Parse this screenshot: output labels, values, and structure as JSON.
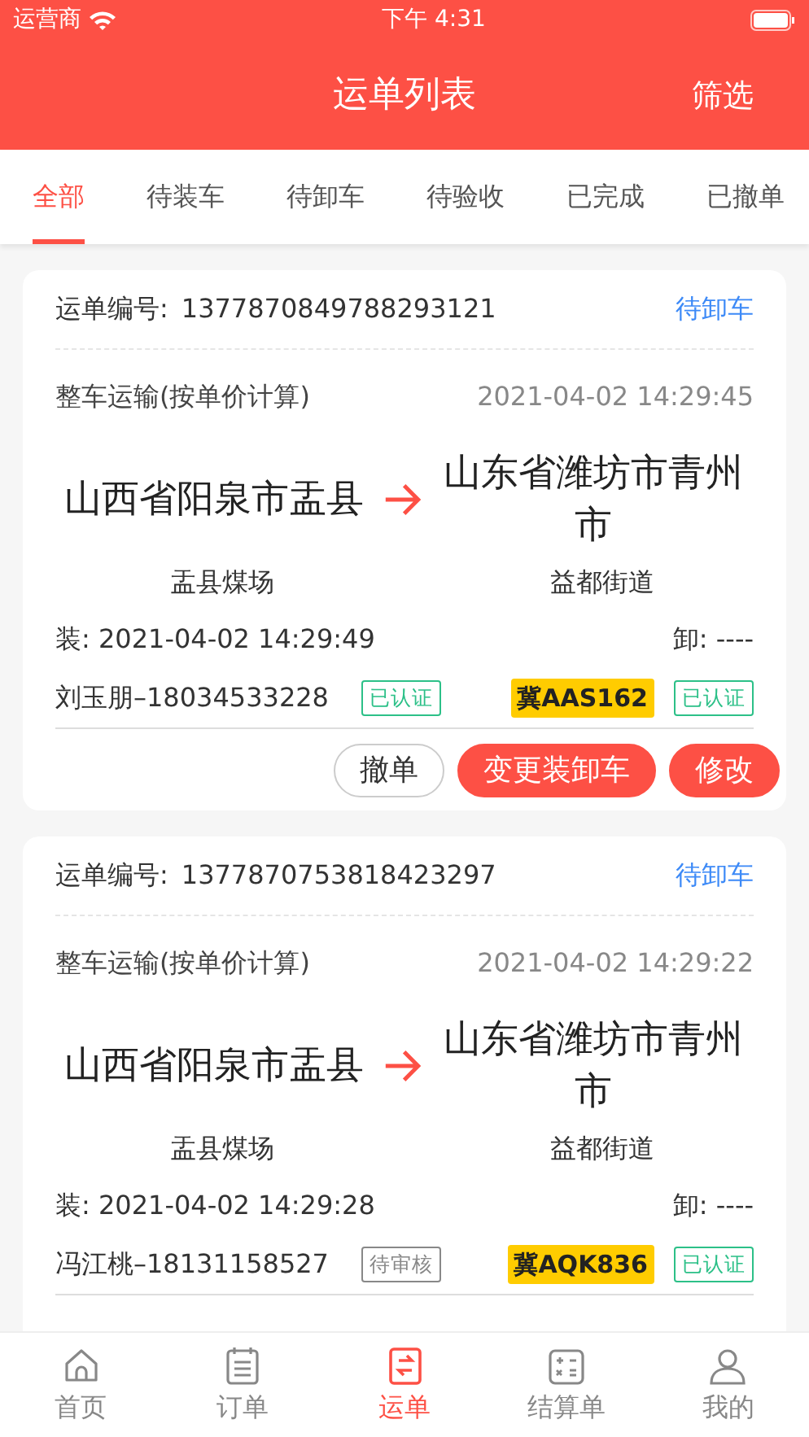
{
  "status_bar": {
    "carrier": "运营商",
    "time": "下午 4:31"
  },
  "header": {
    "title": "运单列表",
    "action": "筛选"
  },
  "tabs": [
    {
      "label": "全部",
      "selected": true
    },
    {
      "label": "待装车",
      "selected": false
    },
    {
      "label": "待卸车",
      "selected": false
    },
    {
      "label": "待验收",
      "selected": false
    },
    {
      "label": "已完成",
      "selected": false
    },
    {
      "label": "已撤单",
      "selected": false
    }
  ],
  "waybills": [
    {
      "number_label": "运单编号:",
      "number": "1377870849788293121",
      "status": "待卸车",
      "type": "整车运输(按单价计算)",
      "created": "2021-04-02 14:29:45",
      "origin": "山西省阳泉市盂县",
      "destination": "山东省潍坊市青州市",
      "origin_place": "盂县煤场",
      "destination_place": "益都街道",
      "load": "装: 2021-04-02 14:29:49",
      "unload": "卸: ----",
      "driver": "刘玉朋–18034533228",
      "driver_badge": {
        "text": "已认证",
        "verified": true
      },
      "plate": "冀AAS162",
      "vehicle_badge": {
        "text": "已认证",
        "verified": true
      },
      "buttons": [
        {
          "label": "撤单",
          "kind": "outline"
        },
        {
          "label": "变更装卸车",
          "kind": "primary"
        },
        {
          "label": "修改",
          "kind": "primary"
        }
      ]
    },
    {
      "number_label": "运单编号:",
      "number": "1377870753818423297",
      "status": "待卸车",
      "type": "整车运输(按单价计算)",
      "created": "2021-04-02 14:29:22",
      "origin": "山西省阳泉市盂县",
      "destination": "山东省潍坊市青州市",
      "origin_place": "盂县煤场",
      "destination_place": "益都街道",
      "load": "装: 2021-04-02 14:29:28",
      "unload": "卸: ----",
      "driver": "冯江桃–18131158527",
      "driver_badge": {
        "text": "待审核",
        "verified": false
      },
      "plate": "冀AQK836",
      "vehicle_badge": {
        "text": "已认证",
        "verified": true
      }
    }
  ],
  "tab_bar": [
    {
      "label": "首页",
      "selected": false
    },
    {
      "label": "订单",
      "selected": false
    },
    {
      "label": "运单",
      "selected": true
    },
    {
      "label": "结算单",
      "selected": false
    },
    {
      "label": "我的",
      "selected": false
    }
  ]
}
